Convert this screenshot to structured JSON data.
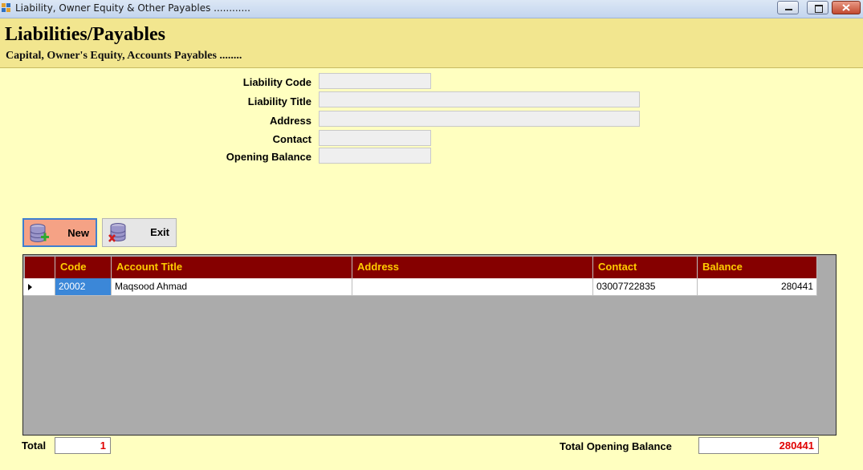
{
  "window": {
    "title": "Liability, Owner Equity & Other Payables ............"
  },
  "header": {
    "title": "Liabilities/Payables",
    "subtitle": "Capital, Owner's Equity, Accounts Payables ........"
  },
  "form": {
    "liability_code_label": "Liability Code",
    "liability_code_value": "",
    "liability_title_label": "Liability Title",
    "liability_title_value": "",
    "address_label": "Address",
    "address_value": "",
    "contact_label": "Contact",
    "contact_value": "",
    "opening_balance_label": "Opening Balance",
    "opening_balance_value": ""
  },
  "buttons": {
    "new_label": "New",
    "exit_label": "Exit"
  },
  "grid": {
    "columns": [
      "Code",
      "Account Title",
      "Address",
      "Contact",
      "Balance"
    ],
    "rows": [
      {
        "code": "20002",
        "account_title": "Maqsood Ahmad",
        "address": "",
        "contact": "03007722835",
        "balance": "280441"
      }
    ]
  },
  "footer": {
    "total_label": "Total",
    "total_value": "1",
    "total_opening_balance_label": "Total Opening Balance",
    "total_opening_balance_value": "280441"
  },
  "colors": {
    "background": "#ffffc0",
    "header_band": "#f2e68f",
    "grid_header": "#850000",
    "grid_header_text": "#ffcc00",
    "total_text": "#e00000",
    "new_button": "#f5a285"
  }
}
